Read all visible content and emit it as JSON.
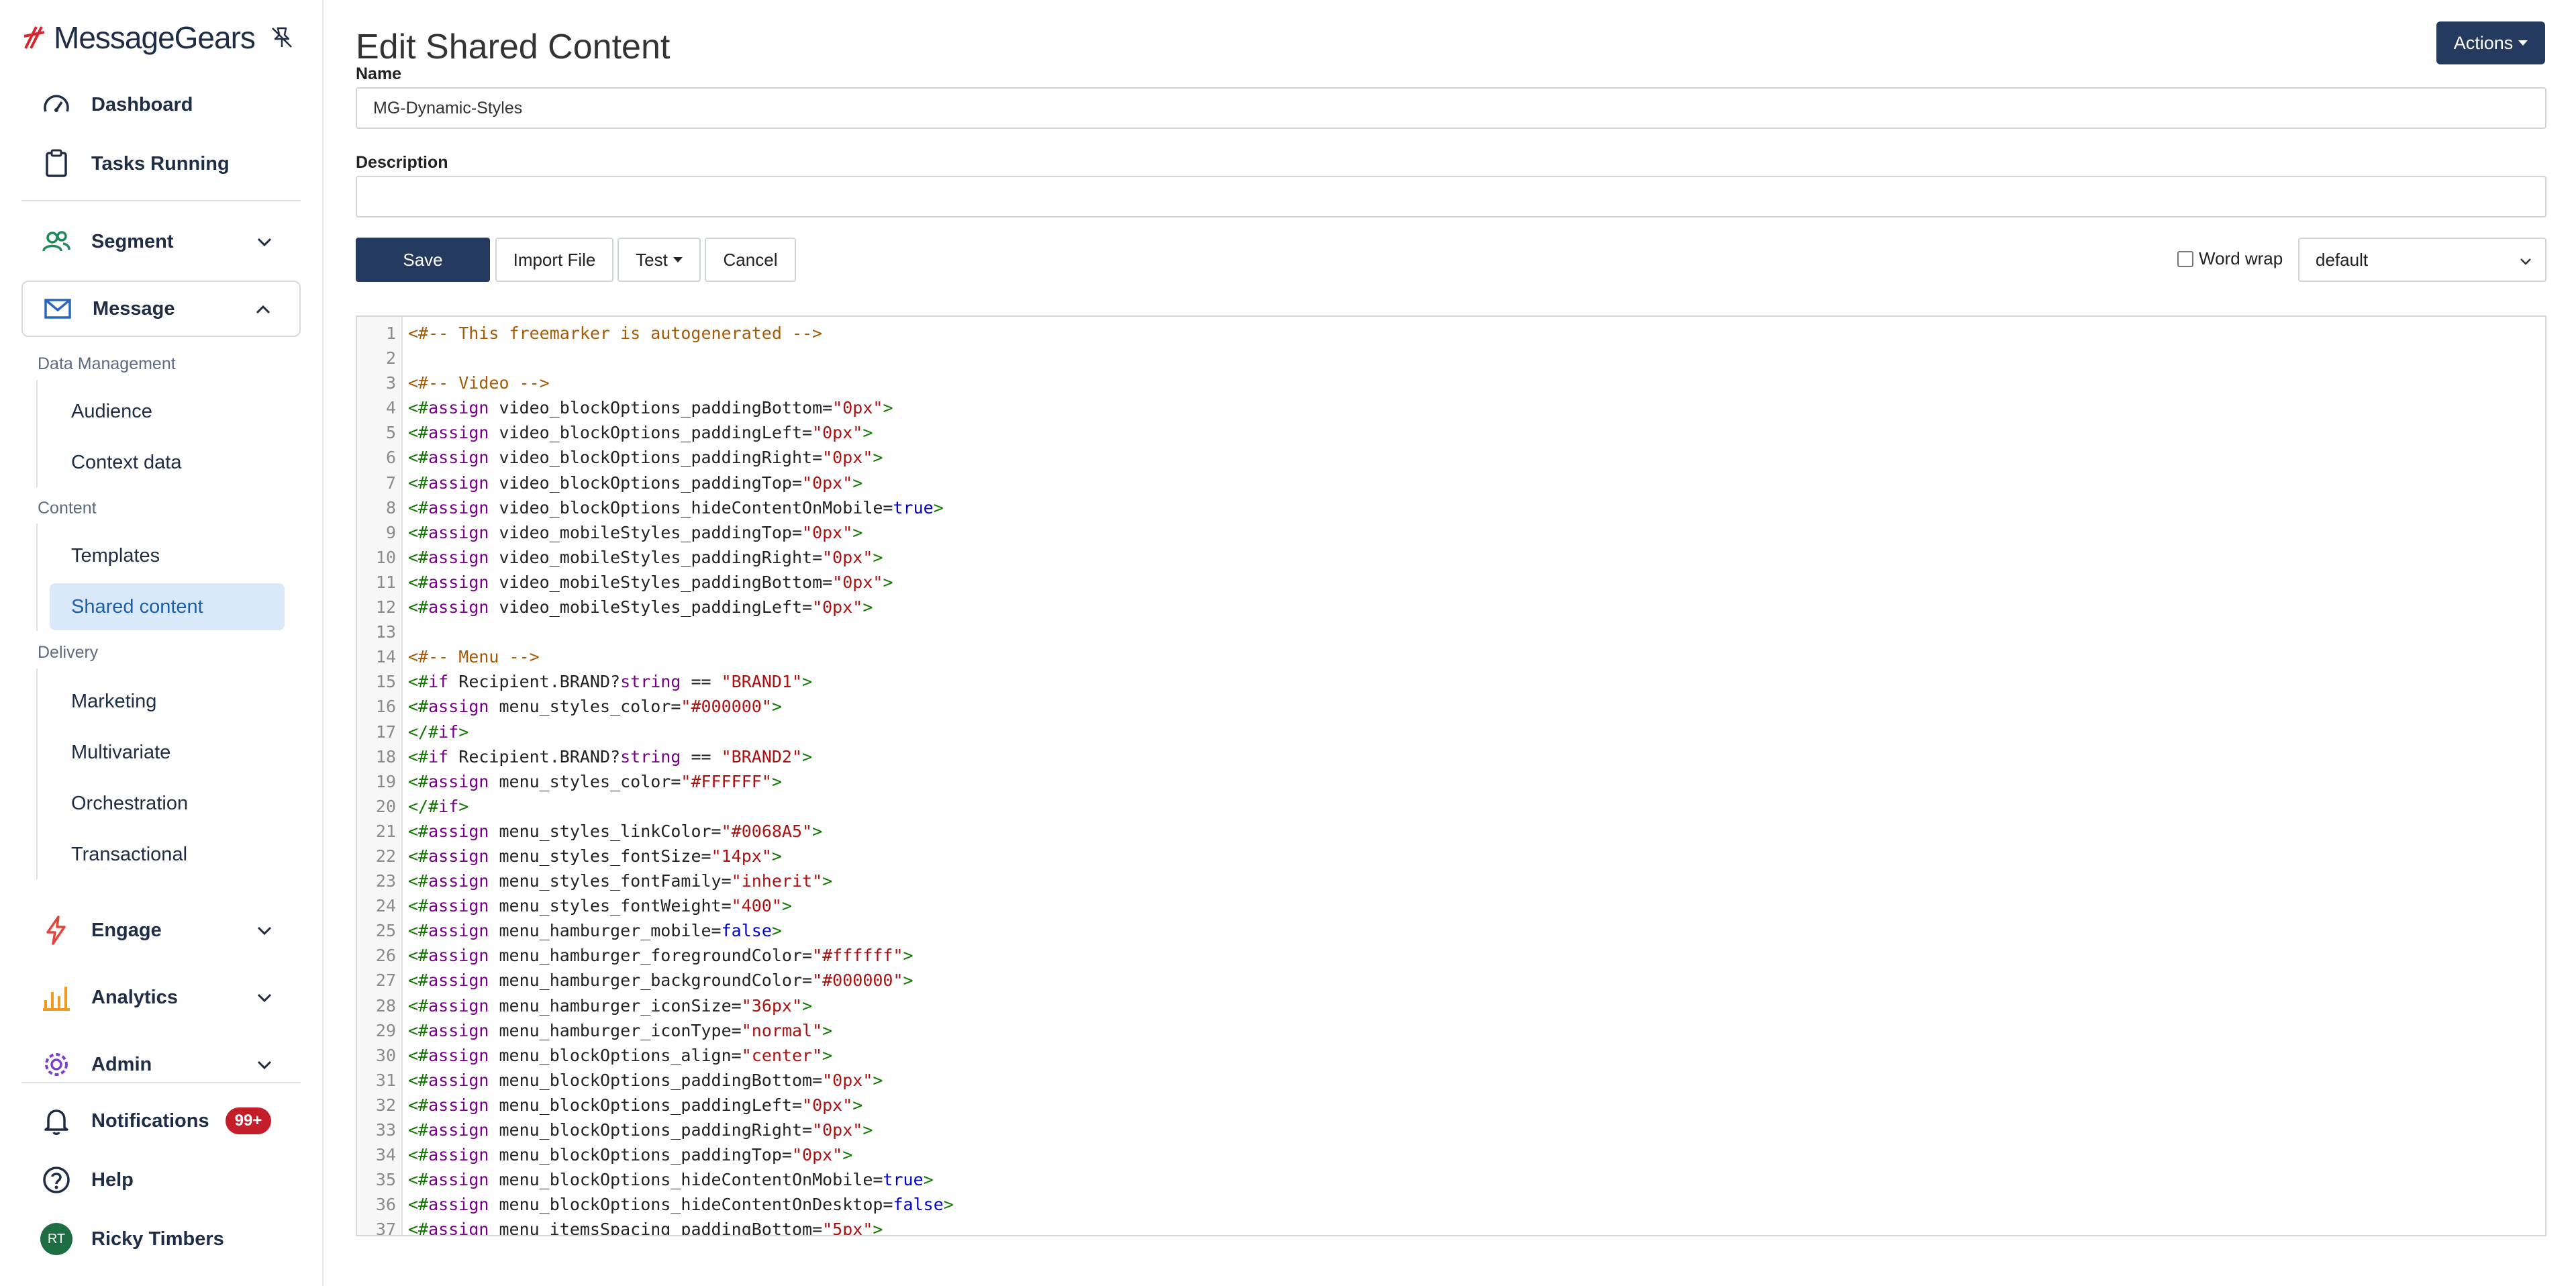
{
  "brand": {
    "name": "MessageGears"
  },
  "sidebar": {
    "top_items": [
      {
        "label": "Dashboard",
        "icon": "gauge-icon"
      },
      {
        "label": "Tasks Running",
        "icon": "clipboard-icon"
      }
    ],
    "sections": [
      {
        "label": "Segment",
        "icon": "users-icon"
      },
      {
        "label": "Message",
        "icon": "envelope-icon"
      }
    ],
    "message_groups": [
      {
        "heading": "Data Management",
        "items": [
          "Audience",
          "Context data"
        ]
      },
      {
        "heading": "Content",
        "items": [
          "Templates",
          "Shared content"
        ]
      },
      {
        "heading": "Delivery",
        "items": [
          "Marketing",
          "Multivariate",
          "Orchestration",
          "Transactional"
        ]
      }
    ],
    "active_item": "Shared content",
    "other_sections": [
      {
        "label": "Engage",
        "icon": "bolt-icon",
        "color": "#e0463c"
      },
      {
        "label": "Analytics",
        "icon": "bar-chart-icon",
        "color": "#f29a1c"
      },
      {
        "label": "Admin",
        "icon": "gear-icon",
        "color": "#7d3fcf"
      }
    ],
    "bottom": {
      "notifications_label": "Notifications",
      "notifications_badge": "99+",
      "help_label": "Help",
      "user_name": "Ricky Timbers",
      "user_initials": "RT"
    }
  },
  "page": {
    "title": "Edit Shared Content",
    "actions_label": "Actions",
    "name_label": "Name",
    "name_value": "MG-Dynamic-Styles",
    "description_label": "Description",
    "description_value": "",
    "buttons": {
      "save": "Save",
      "import": "Import File",
      "test": "Test",
      "cancel": "Cancel"
    },
    "word_wrap_label": "Word wrap",
    "word_wrap_checked": false,
    "theme_value": "default"
  },
  "colors": {
    "primary": "#243a5e",
    "active_bg": "#d9e9fa",
    "badge": "#c41e2a"
  },
  "editor": {
    "lines": [
      [
        [
          "cm",
          "<#-- This freemarker is autogenerated -->"
        ]
      ],
      [],
      [
        [
          "cm",
          "<#-- Video -->"
        ]
      ],
      [
        [
          "tg",
          "<#"
        ],
        [
          "kw",
          "assign"
        ],
        [
          "",
          " video_blockOptions_paddingBottom="
        ],
        [
          "st",
          "\"0px\""
        ],
        [
          "tg",
          ">"
        ]
      ],
      [
        [
          "tg",
          "<#"
        ],
        [
          "kw",
          "assign"
        ],
        [
          "",
          " video_blockOptions_paddingLeft="
        ],
        [
          "st",
          "\"0px\""
        ],
        [
          "tg",
          ">"
        ]
      ],
      [
        [
          "tg",
          "<#"
        ],
        [
          "kw",
          "assign"
        ],
        [
          "",
          " video_blockOptions_paddingRight="
        ],
        [
          "st",
          "\"0px\""
        ],
        [
          "tg",
          ">"
        ]
      ],
      [
        [
          "tg",
          "<#"
        ],
        [
          "kw",
          "assign"
        ],
        [
          "",
          " video_blockOptions_paddingTop="
        ],
        [
          "st",
          "\"0px\""
        ],
        [
          "tg",
          ">"
        ]
      ],
      [
        [
          "tg",
          "<#"
        ],
        [
          "kw",
          "assign"
        ],
        [
          "",
          " video_blockOptions_hideContentOnMobile="
        ],
        [
          "at",
          "true"
        ],
        [
          "tg",
          ">"
        ]
      ],
      [
        [
          "tg",
          "<#"
        ],
        [
          "kw",
          "assign"
        ],
        [
          "",
          " video_mobileStyles_paddingTop="
        ],
        [
          "st",
          "\"0px\""
        ],
        [
          "tg",
          ">"
        ]
      ],
      [
        [
          "tg",
          "<#"
        ],
        [
          "kw",
          "assign"
        ],
        [
          "",
          " video_mobileStyles_paddingRight="
        ],
        [
          "st",
          "\"0px\""
        ],
        [
          "tg",
          ">"
        ]
      ],
      [
        [
          "tg",
          "<#"
        ],
        [
          "kw",
          "assign"
        ],
        [
          "",
          " video_mobileStyles_paddingBottom="
        ],
        [
          "st",
          "\"0px\""
        ],
        [
          "tg",
          ">"
        ]
      ],
      [
        [
          "tg",
          "<#"
        ],
        [
          "kw",
          "assign"
        ],
        [
          "",
          " video_mobileStyles_paddingLeft="
        ],
        [
          "st",
          "\"0px\""
        ],
        [
          "tg",
          ">"
        ]
      ],
      [],
      [
        [
          "cm",
          "<#-- Menu -->"
        ]
      ],
      [
        [
          "tg",
          "<#"
        ],
        [
          "kw",
          "if"
        ],
        [
          "",
          " Recipient.BRAND?"
        ],
        [
          "kw",
          "string"
        ],
        [
          "",
          " == "
        ],
        [
          "st",
          "\"BRAND1\""
        ],
        [
          "tg",
          ">"
        ]
      ],
      [
        [
          "tg",
          "<#"
        ],
        [
          "kw",
          "assign"
        ],
        [
          "",
          " menu_styles_color="
        ],
        [
          "st",
          "\"#000000\""
        ],
        [
          "tg",
          ">"
        ]
      ],
      [
        [
          "tg",
          "</#"
        ],
        [
          "kw",
          "if"
        ],
        [
          "tg",
          ">"
        ]
      ],
      [
        [
          "tg",
          "<#"
        ],
        [
          "kw",
          "if"
        ],
        [
          "",
          " Recipient.BRAND?"
        ],
        [
          "kw",
          "string"
        ],
        [
          "",
          " == "
        ],
        [
          "st",
          "\"BRAND2\""
        ],
        [
          "tg",
          ">"
        ]
      ],
      [
        [
          "tg",
          "<#"
        ],
        [
          "kw",
          "assign"
        ],
        [
          "",
          " menu_styles_color="
        ],
        [
          "st",
          "\"#FFFFFF\""
        ],
        [
          "tg",
          ">"
        ]
      ],
      [
        [
          "tg",
          "</#"
        ],
        [
          "kw",
          "if"
        ],
        [
          "tg",
          ">"
        ]
      ],
      [
        [
          "tg",
          "<#"
        ],
        [
          "kw",
          "assign"
        ],
        [
          "",
          " menu_styles_linkColor="
        ],
        [
          "st",
          "\"#0068A5\""
        ],
        [
          "tg",
          ">"
        ]
      ],
      [
        [
          "tg",
          "<#"
        ],
        [
          "kw",
          "assign"
        ],
        [
          "",
          " menu_styles_fontSize="
        ],
        [
          "st",
          "\"14px\""
        ],
        [
          "tg",
          ">"
        ]
      ],
      [
        [
          "tg",
          "<#"
        ],
        [
          "kw",
          "assign"
        ],
        [
          "",
          " menu_styles_fontFamily="
        ],
        [
          "st",
          "\"inherit\""
        ],
        [
          "tg",
          ">"
        ]
      ],
      [
        [
          "tg",
          "<#"
        ],
        [
          "kw",
          "assign"
        ],
        [
          "",
          " menu_styles_fontWeight="
        ],
        [
          "st",
          "\"400\""
        ],
        [
          "tg",
          ">"
        ]
      ],
      [
        [
          "tg",
          "<#"
        ],
        [
          "kw",
          "assign"
        ],
        [
          "",
          " menu_hamburger_mobile="
        ],
        [
          "at",
          "false"
        ],
        [
          "tg",
          ">"
        ]
      ],
      [
        [
          "tg",
          "<#"
        ],
        [
          "kw",
          "assign"
        ],
        [
          "",
          " menu_hamburger_foregroundColor="
        ],
        [
          "st",
          "\"#ffffff\""
        ],
        [
          "tg",
          ">"
        ]
      ],
      [
        [
          "tg",
          "<#"
        ],
        [
          "kw",
          "assign"
        ],
        [
          "",
          " menu_hamburger_backgroundColor="
        ],
        [
          "st",
          "\"#000000\""
        ],
        [
          "tg",
          ">"
        ]
      ],
      [
        [
          "tg",
          "<#"
        ],
        [
          "kw",
          "assign"
        ],
        [
          "",
          " menu_hamburger_iconSize="
        ],
        [
          "st",
          "\"36px\""
        ],
        [
          "tg",
          ">"
        ]
      ],
      [
        [
          "tg",
          "<#"
        ],
        [
          "kw",
          "assign"
        ],
        [
          "",
          " menu_hamburger_iconType="
        ],
        [
          "st",
          "\"normal\""
        ],
        [
          "tg",
          ">"
        ]
      ],
      [
        [
          "tg",
          "<#"
        ],
        [
          "kw",
          "assign"
        ],
        [
          "",
          " menu_blockOptions_align="
        ],
        [
          "st",
          "\"center\""
        ],
        [
          "tg",
          ">"
        ]
      ],
      [
        [
          "tg",
          "<#"
        ],
        [
          "kw",
          "assign"
        ],
        [
          "",
          " menu_blockOptions_paddingBottom="
        ],
        [
          "st",
          "\"0px\""
        ],
        [
          "tg",
          ">"
        ]
      ],
      [
        [
          "tg",
          "<#"
        ],
        [
          "kw",
          "assign"
        ],
        [
          "",
          " menu_blockOptions_paddingLeft="
        ],
        [
          "st",
          "\"0px\""
        ],
        [
          "tg",
          ">"
        ]
      ],
      [
        [
          "tg",
          "<#"
        ],
        [
          "kw",
          "assign"
        ],
        [
          "",
          " menu_blockOptions_paddingRight="
        ],
        [
          "st",
          "\"0px\""
        ],
        [
          "tg",
          ">"
        ]
      ],
      [
        [
          "tg",
          "<#"
        ],
        [
          "kw",
          "assign"
        ],
        [
          "",
          " menu_blockOptions_paddingTop="
        ],
        [
          "st",
          "\"0px\""
        ],
        [
          "tg",
          ">"
        ]
      ],
      [
        [
          "tg",
          "<#"
        ],
        [
          "kw",
          "assign"
        ],
        [
          "",
          " menu_blockOptions_hideContentOnMobile="
        ],
        [
          "at",
          "true"
        ],
        [
          "tg",
          ">"
        ]
      ],
      [
        [
          "tg",
          "<#"
        ],
        [
          "kw",
          "assign"
        ],
        [
          "",
          " menu_blockOptions_hideContentOnDesktop="
        ],
        [
          "at",
          "false"
        ],
        [
          "tg",
          ">"
        ]
      ],
      [
        [
          "tg",
          "<#"
        ],
        [
          "kw",
          "assign"
        ],
        [
          "",
          " menu_itemsSpacing_paddingBottom="
        ],
        [
          "st",
          "\"5px\""
        ],
        [
          "tg",
          ">"
        ]
      ]
    ]
  }
}
